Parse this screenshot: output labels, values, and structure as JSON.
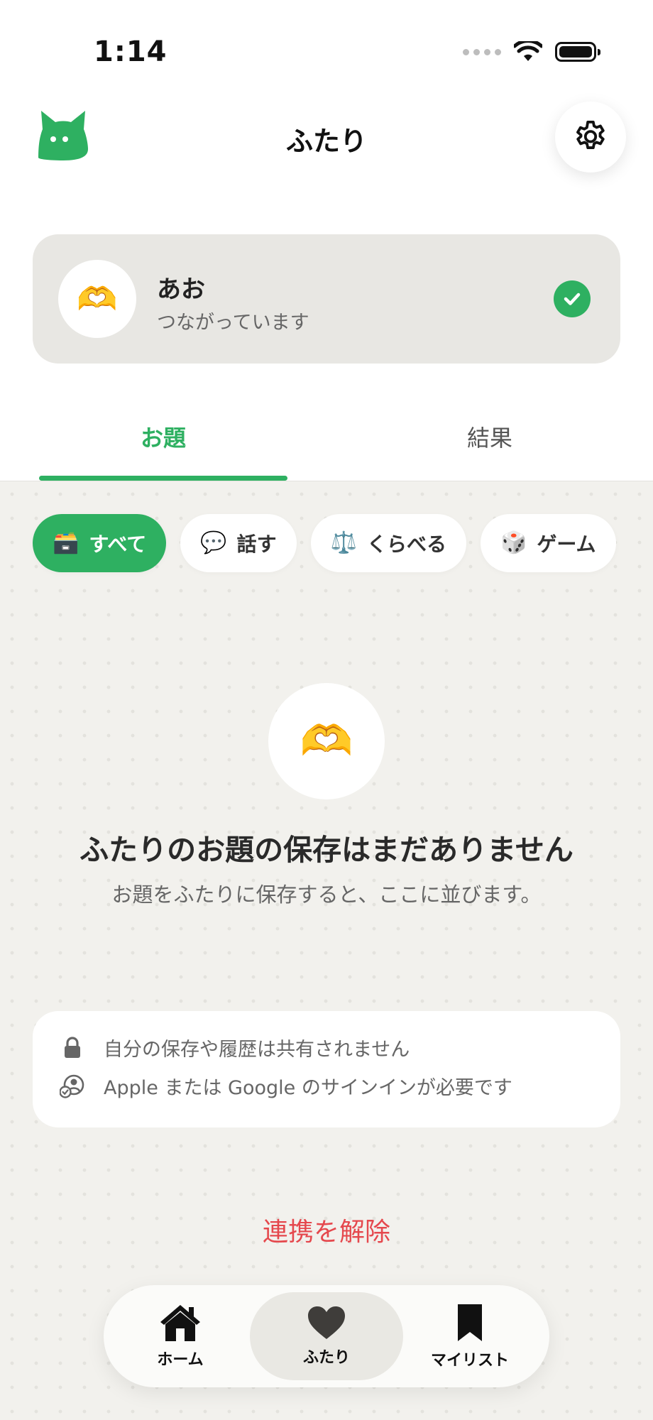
{
  "status_bar": {
    "time": "1:14"
  },
  "header": {
    "title": "ふたり",
    "logo_icon": "cat-icon",
    "settings_icon": "gear-icon"
  },
  "partner": {
    "name": "あお",
    "status": "つながっています",
    "avatar_emoji": "🫶",
    "connected_icon": "check-icon"
  },
  "tabs": [
    {
      "label": "お題",
      "active": true
    },
    {
      "label": "結果",
      "active": false
    }
  ],
  "filters": [
    {
      "emoji": "🗃️",
      "label": "すべて",
      "active": true
    },
    {
      "emoji": "💬",
      "label": "話す",
      "active": false
    },
    {
      "emoji": "⚖️",
      "label": "くらべる",
      "active": false
    },
    {
      "emoji": "🎲",
      "label": "ゲーム",
      "active": false
    }
  ],
  "empty_state": {
    "emoji": "🫶",
    "title": "ふたりのお題の保存はまだありません",
    "subtitle": "お題をふたりに保存すると、ここに並びます。"
  },
  "info": {
    "privacy_text": "自分の保存や履歴は共有されません",
    "signin_text": "Apple または Google のサインインが必要です"
  },
  "unlink_label": "連携を解除",
  "bottom_nav": [
    {
      "label": "ホーム",
      "icon": "house-icon",
      "active": false
    },
    {
      "label": "ふたり",
      "icon": "heart-icon",
      "active": true
    },
    {
      "label": "マイリスト",
      "icon": "bookmark-icon",
      "active": false
    }
  ],
  "colors": {
    "accent": "#2eb061",
    "danger": "#e5484d",
    "background": "#f2f1ed"
  }
}
